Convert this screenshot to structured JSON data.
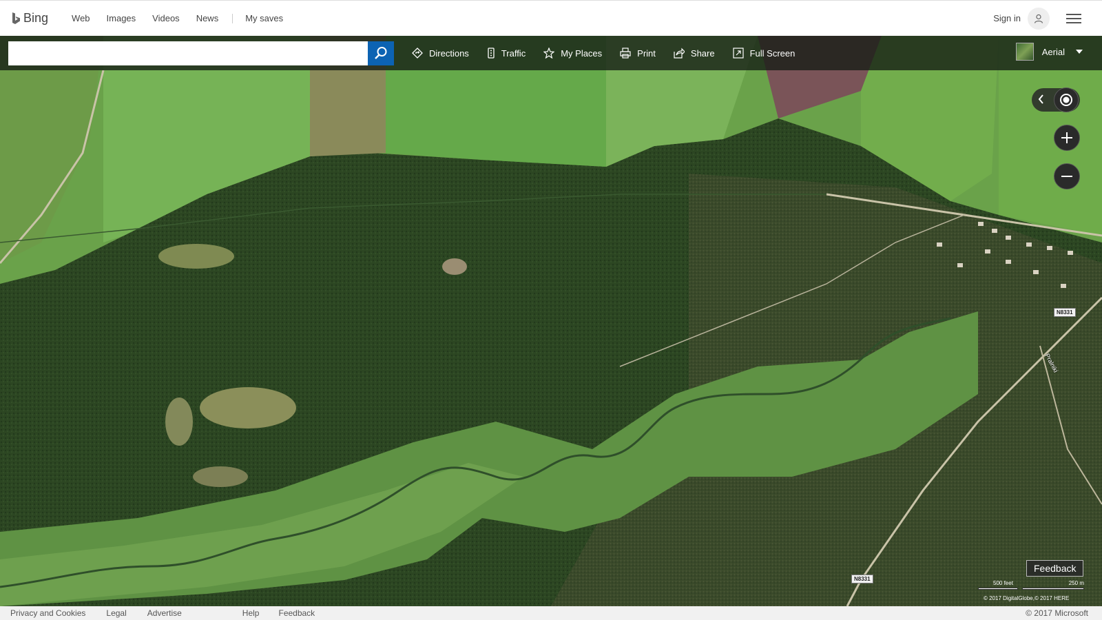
{
  "header": {
    "logo": "Bing",
    "nav": [
      "Web",
      "Images",
      "Videos",
      "News"
    ],
    "my_saves": "My saves",
    "sign_in": "Sign in"
  },
  "toolbar": {
    "search_placeholder": "",
    "directions": "Directions",
    "traffic": "Traffic",
    "my_places": "My Places",
    "print": "Print",
    "share": "Share",
    "full_screen": "Full Screen",
    "map_style": "Aerial"
  },
  "map": {
    "road_labels": [
      "N8331",
      "N8331"
    ],
    "street_label": "Pralniki",
    "feedback": "Feedback",
    "scale_feet": "500 feet",
    "scale_meters": "250 m",
    "imagery_credit": "© 2017 DigitalGlobe,© 2017 HERE"
  },
  "footer": {
    "privacy": "Privacy and Cookies",
    "legal": "Legal",
    "advertise": "Advertise",
    "help": "Help",
    "feedback": "Feedback",
    "copyright": "© 2017 Microsoft"
  },
  "colors": {
    "search_button": "#0c63b3",
    "forest": "#2e4a24",
    "field": "#5fa340",
    "toolbar": "#141c14"
  }
}
